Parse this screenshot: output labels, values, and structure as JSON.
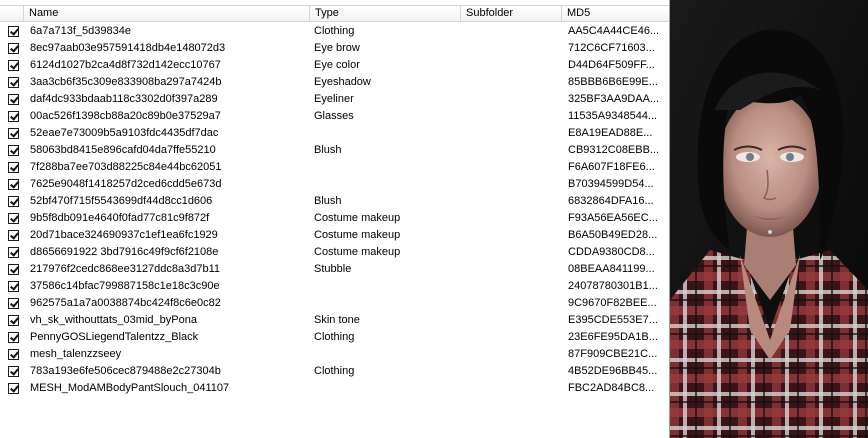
{
  "columns": {
    "name": "Name",
    "type": "Type",
    "subfolder": "Subfolder",
    "md5": "MD5"
  },
  "rows": [
    {
      "name": "6a7a713f_5d39834e",
      "type": "Clothing",
      "subfolder": "",
      "md5": "AA5C4A44CE46...",
      "checked": true
    },
    {
      "name": "8ec97aab03e957591418db4e148072d3",
      "type": "Eye brow",
      "subfolder": "",
      "md5": "712C6CF71603...",
      "checked": true
    },
    {
      "name": "6124d1027b2ca4d8f732d142ecc10767",
      "type": "Eye color",
      "subfolder": "",
      "md5": "D44D64F509FF...",
      "checked": true
    },
    {
      "name": "3aa3cb6f35c309e833908ba297a7424b",
      "type": "Eyeshadow",
      "subfolder": "",
      "md5": "85BBB6B6E99E...",
      "checked": true
    },
    {
      "name": "daf4dc933bdaab118c3302d0f397a289",
      "type": "Eyeliner",
      "subfolder": "",
      "md5": "325BF3AA9DAA...",
      "checked": true
    },
    {
      "name": "00ac526f1398cb88a20c89b0e37529a7",
      "type": "Glasses",
      "subfolder": "",
      "md5": "11535A9348544...",
      "checked": true
    },
    {
      "name": "52eae7e73009b5a9103fdc4435df7dac",
      "type": "",
      "subfolder": "",
      "md5": "E8A19EAD88E...",
      "checked": true
    },
    {
      "name": "58063bd8415e896cafd04da7ffe55210",
      "type": "Blush",
      "subfolder": "",
      "md5": "CB9312C08EBB...",
      "checked": true
    },
    {
      "name": "7f288ba7ee703d88225c84e44bc62051",
      "type": "",
      "subfolder": "",
      "md5": "F6A607F18FE6...",
      "checked": true
    },
    {
      "name": "7625e9048f1418257d2ced6cdd5e673d",
      "type": "",
      "subfolder": "",
      "md5": "B70394599D54...",
      "checked": true
    },
    {
      "name": "52bf470f715f5543699df44d8cc1d606",
      "type": "Blush",
      "subfolder": "",
      "md5": "6832864DFA16...",
      "checked": true
    },
    {
      "name": "9b5f8db091e4640f0fad77c81c9f872f",
      "type": "Costume makeup",
      "subfolder": "",
      "md5": "F93A56EA56EC...",
      "checked": true
    },
    {
      "name": "20d71bace324690937c1ef1ea6fc1929",
      "type": "Costume makeup",
      "subfolder": "",
      "md5": "B6A50B49ED28...",
      "checked": true
    },
    {
      "name": "d8656691922 3bd7916c49f9cf6f2108e",
      "type": "Costume makeup",
      "subfolder": "",
      "md5": "CDDA9380CD8...",
      "checked": true
    },
    {
      "name": "217976f2cedc868ee3127ddc8a3d7b11",
      "type": "Stubble",
      "subfolder": "",
      "md5": "08BEAA841199...",
      "checked": true
    },
    {
      "name": "37586c14bfac799887158c1e18c3c90e",
      "type": "",
      "subfolder": "",
      "md5": "24078780301B1...",
      "checked": true
    },
    {
      "name": "962575a1a7a0038874bc424f8c6e0c82",
      "type": "",
      "subfolder": "",
      "md5": "9C9670F82BEE...",
      "checked": true
    },
    {
      "name": "vh_sk_withouttats_03mid_byPona",
      "type": "Skin tone",
      "subfolder": "",
      "md5": "E395CDE553E7...",
      "checked": true
    },
    {
      "name": "PennyGOSLiegendTalentzz_Black",
      "type": "Clothing",
      "subfolder": "",
      "md5": "23E6FE95DA1B...",
      "checked": true
    },
    {
      "name": "mesh_talenzzseey",
      "type": "",
      "subfolder": "",
      "md5": "87F909CBE21C...",
      "checked": true
    },
    {
      "name": "783a193e6fe506cec879488e2c27304b",
      "type": "Clothing",
      "subfolder": "",
      "md5": "4B52DE96BB45...",
      "checked": true
    },
    {
      "name": "MESH_ModAMBodyPantSlouch_041107",
      "type": "",
      "subfolder": "",
      "md5": "FBC2AD84BC8...",
      "checked": true
    }
  ]
}
